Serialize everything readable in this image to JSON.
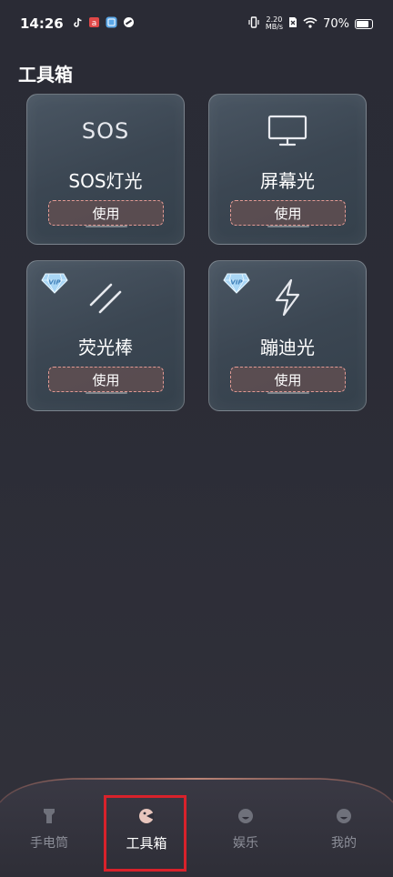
{
  "status_bar": {
    "time": "14:26",
    "net_speed_value": "2.20",
    "net_speed_unit": "MB/s",
    "battery": "70%"
  },
  "page": {
    "title": "工具箱"
  },
  "cards": [
    {
      "label": "SOS灯光",
      "button": "使用",
      "icon_text": "SOS",
      "vip": false,
      "icon": "sos-icon"
    },
    {
      "label": "屏幕光",
      "button": "使用",
      "vip": false,
      "icon": "monitor-icon"
    },
    {
      "label": "荧光棒",
      "button": "使用",
      "vip": true,
      "icon": "glow-stick-icon"
    },
    {
      "label": "蹦迪光",
      "button": "使用",
      "vip": true,
      "icon": "lightning-icon"
    }
  ],
  "vip_badge_text": "VIP",
  "bottom_nav": [
    {
      "label": "手电筒",
      "icon": "flashlight-icon",
      "active": false
    },
    {
      "label": "工具箱",
      "icon": "toolbox-icon",
      "active": true
    },
    {
      "label": "娱乐",
      "icon": "entertainment-icon",
      "active": false
    },
    {
      "label": "我的",
      "icon": "profile-icon",
      "active": false
    }
  ],
  "colors": {
    "accent_border": "#e29a94",
    "highlight": "#d8222b",
    "background": "#2b2c36"
  }
}
